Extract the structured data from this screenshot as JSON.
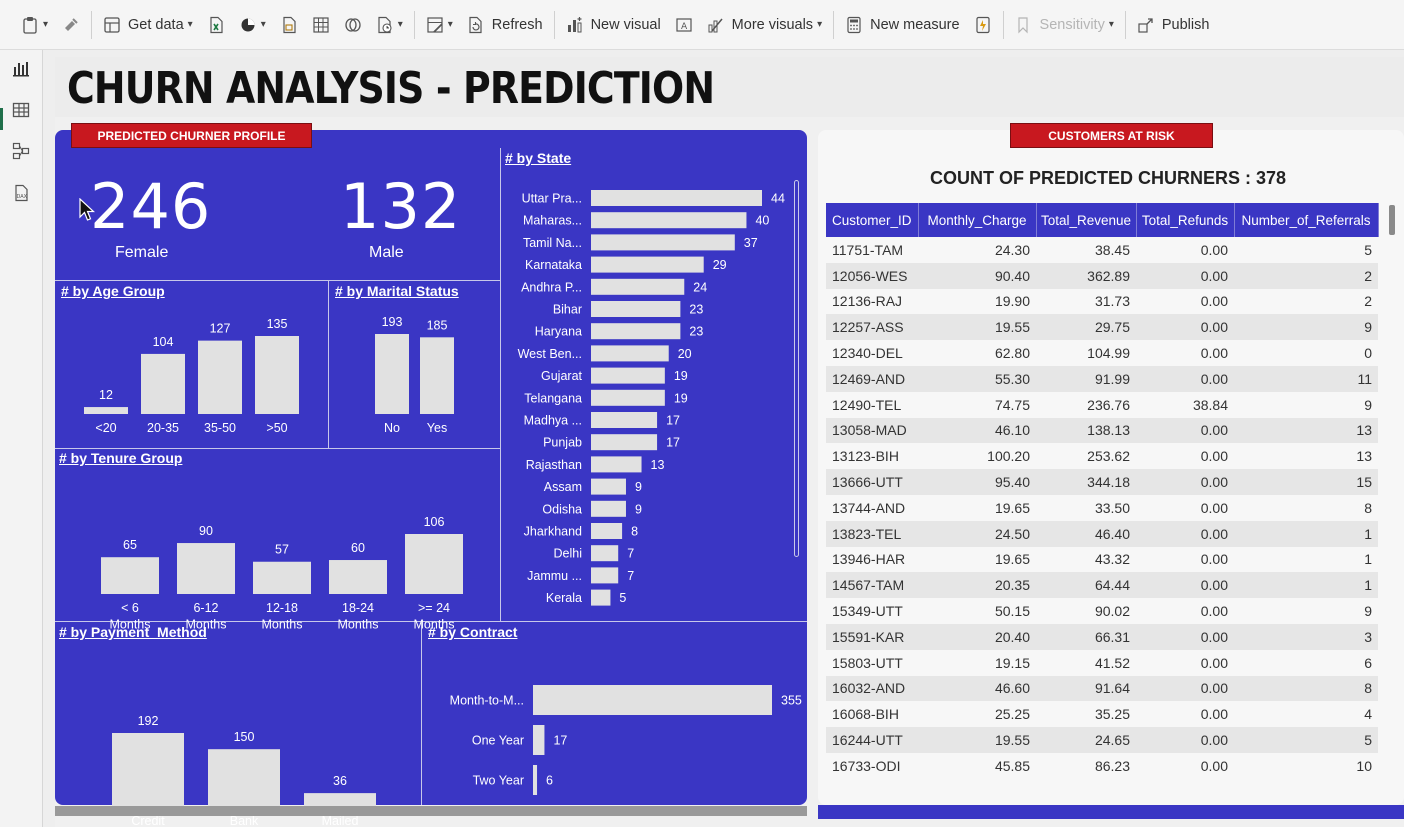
{
  "ribbon": {
    "items": [
      {
        "name": "paste",
        "label": "",
        "chev": true
      },
      {
        "name": "format-painter",
        "label": ""
      },
      {
        "name": "get-data",
        "label": "Get data",
        "chev": true
      },
      {
        "name": "excel",
        "label": ""
      },
      {
        "name": "data-hub",
        "label": "",
        "chev": true
      },
      {
        "name": "sql",
        "label": ""
      },
      {
        "name": "enter-data",
        "label": ""
      },
      {
        "name": "dataverse",
        "label": ""
      },
      {
        "name": "recent-sources",
        "label": "",
        "chev": true
      },
      {
        "name": "transform",
        "label": "",
        "chev": true
      },
      {
        "name": "refresh",
        "label": "Refresh"
      },
      {
        "name": "new-visual",
        "label": "New visual"
      },
      {
        "name": "text-box",
        "label": ""
      },
      {
        "name": "more-visuals",
        "label": "More visuals",
        "chev": true
      },
      {
        "name": "new-measure",
        "label": "New measure"
      },
      {
        "name": "quick-measure",
        "label": ""
      },
      {
        "name": "sensitivity",
        "label": "Sensitivity",
        "chev": true,
        "disabled": true
      },
      {
        "name": "publish",
        "label": "Publish"
      }
    ]
  },
  "report": {
    "title": "CHURN ANALYSIS - PREDICTION",
    "left_tag": "PREDICTED CHURNER PROFILE",
    "right_tag": "CUSTOMERS AT RISK",
    "count_title": "COUNT OF PREDICTED CHURNERS : 378"
  },
  "kpi": {
    "female_value": "246",
    "female_label": "Female",
    "male_value": "132",
    "male_label": "Male"
  },
  "colors": {
    "panel": "#3a36c4",
    "bar": "#e1e1e1",
    "tag_red": "#c8181f"
  },
  "chart_data": [
    {
      "id": "state",
      "type": "bar",
      "orientation": "horizontal",
      "title": "# by State",
      "categories": [
        "Uttar Pra...",
        "Maharas...",
        "Tamil Na...",
        "Karnataka",
        "Andhra P...",
        "Bihar",
        "Haryana",
        "West Ben...",
        "Gujarat",
        "Telangana",
        "Madhya ...",
        "Punjab",
        "Rajasthan",
        "Assam",
        "Odisha",
        "Jharkhand",
        "Delhi",
        "Jammu ...",
        "Kerala"
      ],
      "values": [
        44,
        40,
        37,
        29,
        24,
        23,
        23,
        20,
        19,
        19,
        17,
        17,
        13,
        9,
        9,
        8,
        7,
        7,
        5
      ]
    },
    {
      "id": "age",
      "type": "bar",
      "title": "# by Age Group",
      "categories": [
        "<20",
        "20-35",
        "35-50",
        ">50"
      ],
      "values": [
        12,
        104,
        127,
        135
      ]
    },
    {
      "id": "marital",
      "type": "bar",
      "title": "# by Marital Status",
      "categories": [
        "No",
        "Yes"
      ],
      "values": [
        193,
        185
      ]
    },
    {
      "id": "tenure",
      "type": "bar",
      "title": "# by Tenure Group",
      "categories": [
        "< 6 Months",
        "6-12 Months",
        "12-18 Months",
        "18-24 Months",
        ">= 24 Months"
      ],
      "values": [
        65,
        90,
        57,
        60,
        106
      ]
    },
    {
      "id": "payment",
      "type": "bar",
      "title": "# by Payment_Method",
      "categories": [
        "Credit Card",
        "Bank Withdrawal",
        "Mailed Check"
      ],
      "values": [
        192,
        150,
        36
      ]
    },
    {
      "id": "contract",
      "type": "bar",
      "orientation": "horizontal",
      "title": "# by Contract",
      "categories": [
        "Month-to-M...",
        "One Year",
        "Two Year"
      ],
      "values": [
        355,
        17,
        6
      ]
    }
  ],
  "table": {
    "columns": [
      "Customer_ID",
      "Monthly_Charge",
      "Total_Revenue",
      "Total_Refunds",
      "Number_of_Referrals"
    ],
    "rows": [
      [
        "11751-TAM",
        "24.30",
        "38.45",
        "0.00",
        "5"
      ],
      [
        "12056-WES",
        "90.40",
        "362.89",
        "0.00",
        "2"
      ],
      [
        "12136-RAJ",
        "19.90",
        "31.73",
        "0.00",
        "2"
      ],
      [
        "12257-ASS",
        "19.55",
        "29.75",
        "0.00",
        "9"
      ],
      [
        "12340-DEL",
        "62.80",
        "104.99",
        "0.00",
        "0"
      ],
      [
        "12469-AND",
        "55.30",
        "91.99",
        "0.00",
        "11"
      ],
      [
        "12490-TEL",
        "74.75",
        "236.76",
        "38.84",
        "9"
      ],
      [
        "13058-MAD",
        "46.10",
        "138.13",
        "0.00",
        "13"
      ],
      [
        "13123-BIH",
        "100.20",
        "253.62",
        "0.00",
        "13"
      ],
      [
        "13666-UTT",
        "95.40",
        "344.18",
        "0.00",
        "15"
      ],
      [
        "13744-AND",
        "19.65",
        "33.50",
        "0.00",
        "8"
      ],
      [
        "13823-TEL",
        "24.50",
        "46.40",
        "0.00",
        "1"
      ],
      [
        "13946-HAR",
        "19.65",
        "43.32",
        "0.00",
        "1"
      ],
      [
        "14567-TAM",
        "20.35",
        "64.44",
        "0.00",
        "1"
      ],
      [
        "15349-UTT",
        "50.15",
        "90.02",
        "0.00",
        "9"
      ],
      [
        "15591-KAR",
        "20.40",
        "66.31",
        "0.00",
        "3"
      ],
      [
        "15803-UTT",
        "19.15",
        "41.52",
        "0.00",
        "6"
      ],
      [
        "16032-AND",
        "46.60",
        "91.64",
        "0.00",
        "8"
      ],
      [
        "16068-BIH",
        "25.25",
        "35.25",
        "0.00",
        "4"
      ],
      [
        "16244-UTT",
        "19.55",
        "24.65",
        "0.00",
        "5"
      ],
      [
        "16733-ODI",
        "45.85",
        "86.23",
        "0.00",
        "10"
      ]
    ]
  }
}
